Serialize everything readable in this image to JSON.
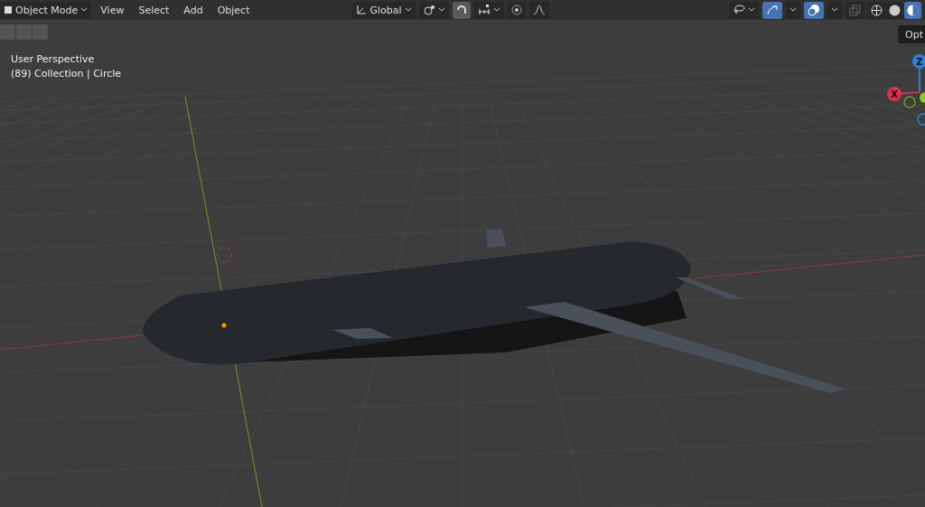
{
  "header": {
    "mode_menu": "Object Mode",
    "menus": [
      "View",
      "Select",
      "Add",
      "Object"
    ],
    "orientation": "Global",
    "snap_on": true,
    "proportional_on": false,
    "overlays_on": true,
    "gizmos_on": true,
    "xray_on": false,
    "shading_modes": [
      {
        "kind": "wireframe",
        "selected": false
      },
      {
        "kind": "solid",
        "selected": false
      },
      {
        "kind": "material",
        "selected": true
      }
    ]
  },
  "viewport": {
    "info": [
      "User Perspective",
      "(89) Collection | Circle"
    ],
    "options_button": "Opt",
    "axes": [
      {
        "label": "Z",
        "color": "#2f7fd8"
      },
      {
        "label": "X",
        "color": "#d8344b"
      }
    ]
  }
}
